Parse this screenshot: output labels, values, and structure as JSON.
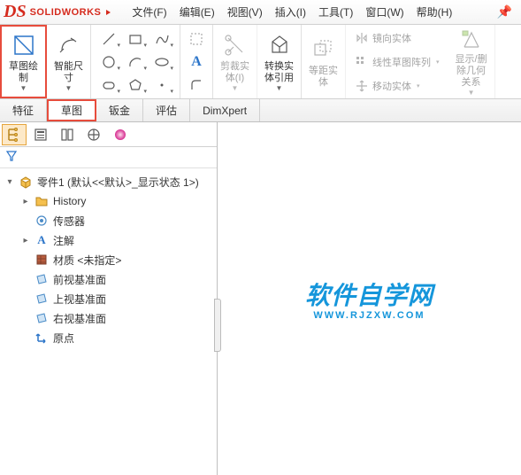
{
  "app": {
    "logo_text": "SOLIDWORKS"
  },
  "menu": [
    {
      "label": "文件(F)"
    },
    {
      "label": "编辑(E)"
    },
    {
      "label": "视图(V)"
    },
    {
      "label": "插入(I)"
    },
    {
      "label": "工具(T)"
    },
    {
      "label": "窗口(W)"
    },
    {
      "label": "帮助(H)"
    }
  ],
  "ribbon": {
    "sketch_btn": "草图绘\n制",
    "smart_dim": "智能尺\n寸",
    "trim": "剪裁实\n体(I)",
    "convert": "转换实\n体引用",
    "offset_label": "等距实\n体",
    "mirror": "镜向实体",
    "pattern": "线性草图阵列",
    "move": "移动实体",
    "display": "显示/删\n除几何\n关系"
  },
  "tabs": [
    {
      "name": "特征"
    },
    {
      "name": "草图"
    },
    {
      "name": "钣金"
    },
    {
      "name": "评估"
    },
    {
      "name": "DimXpert"
    }
  ],
  "tree": {
    "root": "零件1  (默认<<默认>_显示状态 1>)",
    "history": "History",
    "sensors": "传感器",
    "annotations": "注解",
    "material": "材质 <未指定>",
    "front_plane": "前视基准面",
    "top_plane": "上视基准面",
    "right_plane": "右视基准面",
    "origin": "原点"
  },
  "watermark": {
    "main": "软件自学网",
    "sub": "WWW.RJZXW.COM"
  }
}
